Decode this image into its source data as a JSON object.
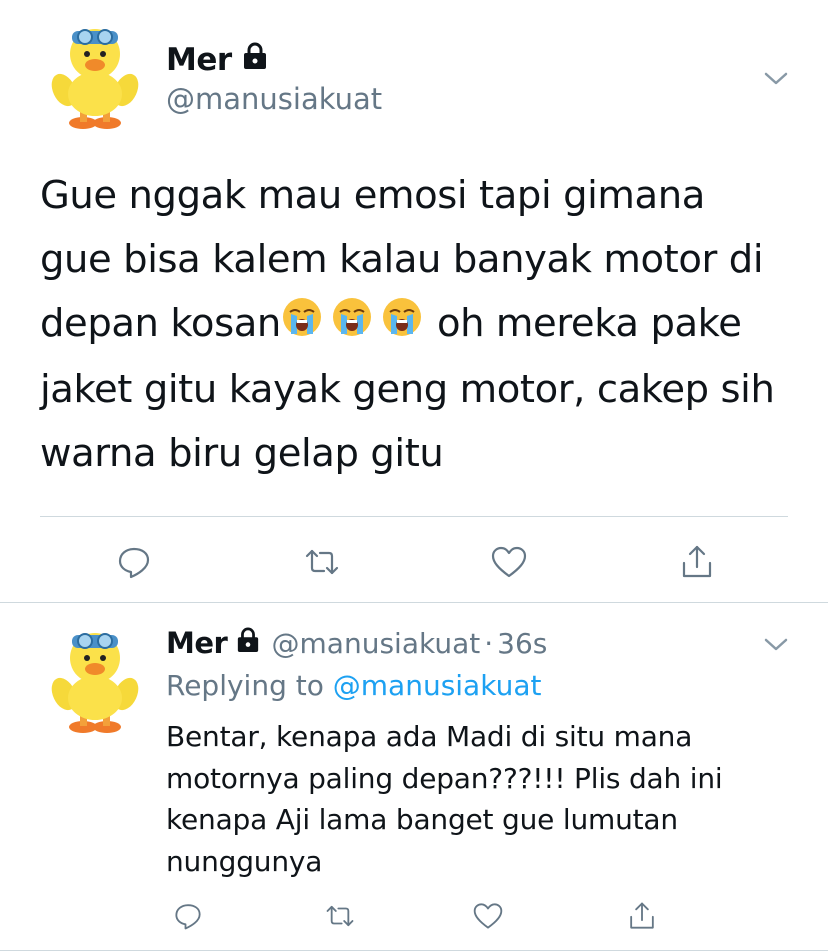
{
  "main_tweet": {
    "author_name": "Mer",
    "author_handle": "@manusiakuat",
    "text_line1": "Gue nggak mau emosi tapi gimana",
    "text_line2": "gue bisa kalem kalau banyak motor di",
    "text_line3_a": "depan kosan",
    "text_line3_b": "oh mereka pake",
    "text_line4": "jaket gitu kayak geng motor, cakep sih",
    "text_line5": "warna biru gelap gitu",
    "emojis": [
      "loudly-crying-face",
      "loudly-crying-face",
      "loudly-crying-face"
    ]
  },
  "reply_tweet": {
    "author_name": "Mer",
    "author_handle": "@manusiakuat",
    "separator": "·",
    "time": "36s",
    "replying_prefix": "Replying to",
    "replying_to": "@manusiakuat",
    "text_line1": "Bentar, kenapa ada Madi di situ mana",
    "text_line2": "motornya paling depan???!!! Plis dah ini",
    "text_line3": "kenapa Aji lama banget gue lumutan",
    "text_line4": "nunggunya"
  },
  "icons": {
    "lock": "lock-icon",
    "chevron": "chevron-down-icon",
    "reply": "reply-icon",
    "retweet": "retweet-icon",
    "like": "like-icon",
    "share": "share-icon",
    "avatar": "duck-avatar"
  },
  "colors": {
    "text": "#0f1419",
    "secondary": "#657786",
    "link": "#1da1f2",
    "divider": "#cfd9de"
  }
}
